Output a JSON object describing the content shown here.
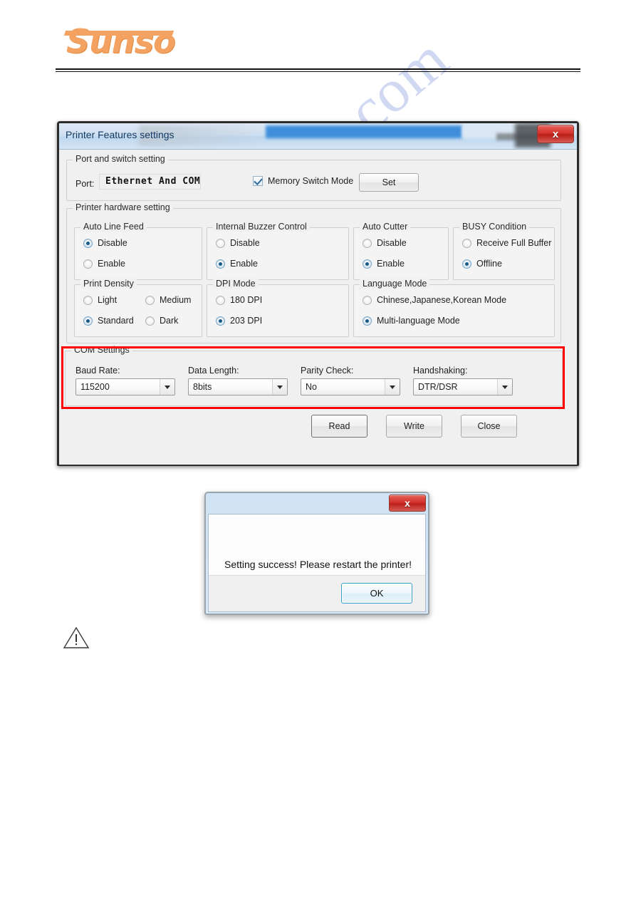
{
  "page": {
    "brand": "Sunso",
    "watermark": "manualshive.com"
  },
  "window": {
    "title": "Printer Features settings",
    "close_label": "x",
    "port_group": {
      "legend": "Port and switch setting",
      "port_label": "Port:",
      "port_value": "Ethernet And COM",
      "memory_switch_label": "Memory Switch Mode",
      "memory_switch_checked": true,
      "set_label": "Set"
    },
    "hardware_group": {
      "legend": "Printer hardware setting",
      "groups": [
        {
          "legend": "Auto Line Feed",
          "options": [
            {
              "label": "Disable",
              "selected": true
            },
            {
              "label": "Enable",
              "selected": false
            }
          ]
        },
        {
          "legend": "Internal Buzzer Control",
          "options": [
            {
              "label": "Disable",
              "selected": false
            },
            {
              "label": "Enable",
              "selected": true
            }
          ]
        },
        {
          "legend": "Auto Cutter",
          "options": [
            {
              "label": "Disable",
              "selected": false
            },
            {
              "label": "Enable",
              "selected": true
            }
          ]
        },
        {
          "legend": "BUSY Condition",
          "options": [
            {
              "label": "Receive Full Buffer",
              "selected": false
            },
            {
              "label": "Offline",
              "selected": true
            }
          ]
        },
        {
          "legend": "Print Density",
          "options": [
            {
              "label": "Light",
              "selected": false
            },
            {
              "label": "Medium",
              "selected": false
            },
            {
              "label": "Standard",
              "selected": true
            },
            {
              "label": "Dark",
              "selected": false
            }
          ]
        },
        {
          "legend": "DPI Mode",
          "options": [
            {
              "label": "180 DPI",
              "selected": false
            },
            {
              "label": "203 DPI",
              "selected": true
            }
          ]
        },
        {
          "legend": "Language Mode",
          "options": [
            {
              "label": "Chinese,Japanese,Korean Mode",
              "selected": false
            },
            {
              "label": "Multi-language Mode",
              "selected": true
            }
          ]
        }
      ]
    },
    "com_group": {
      "legend": "COM Settings",
      "highlight_color": "#ff0000",
      "fields": [
        {
          "label": "Baud Rate:",
          "value": "115200"
        },
        {
          "label": "Data Length:",
          "value": "8bits"
        },
        {
          "label": "Parity Check:",
          "value": "No"
        },
        {
          "label": "Handshaking:",
          "value": "DTR/DSR"
        }
      ]
    },
    "buttons": {
      "read": "Read",
      "write": "Write",
      "close": "Close"
    }
  },
  "message_dialog": {
    "title": "",
    "close_label": "x",
    "text": "Setting success! Please restart the printer!",
    "ok_label": "OK"
  }
}
